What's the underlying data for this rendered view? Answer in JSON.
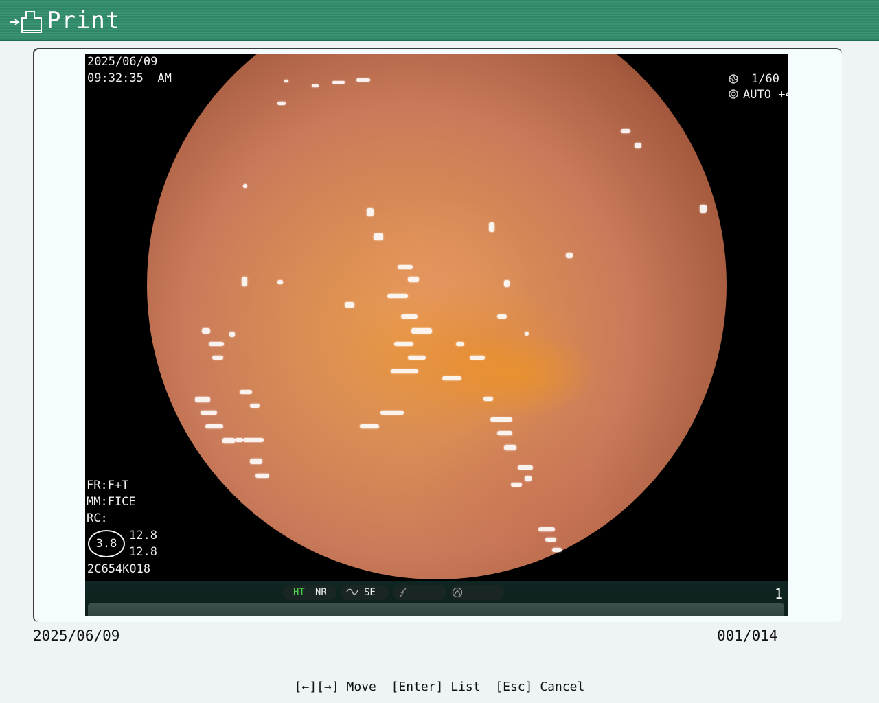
{
  "window": {
    "title": "Print"
  },
  "image": {
    "date": "2025/06/09",
    "time": "09:32:35  AM",
    "shutter": "1/60",
    "iris": "AUTO +4",
    "fr": "FR:F+T",
    "mm": "MM:FICE",
    "rc": "RC:",
    "hemo_value": "3.8",
    "hemo_top": "12.8",
    "hemo_bottom": "12.8",
    "scope_id": "2C654K018",
    "status_items": [
      "HT",
      "NR",
      "SE"
    ],
    "frame_number": "1",
    "colors": {
      "ht_active": "#4cd14c"
    }
  },
  "footer": {
    "date": "2025/06/09",
    "counter": "001/014"
  },
  "help": {
    "move": "[←][→] Move",
    "list": "[Enter] List",
    "cancel": "[Esc] Cancel"
  }
}
